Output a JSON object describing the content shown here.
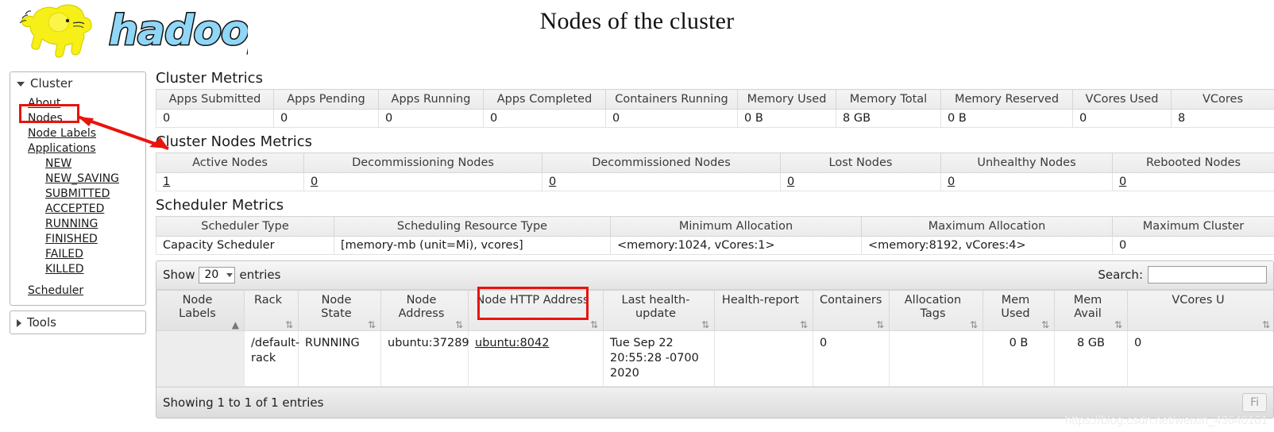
{
  "header": {
    "title": "Nodes of the cluster",
    "logo_text": "hadoop",
    "logo_icon": "hadoop-elephant-logo"
  },
  "sidebar": {
    "cluster": {
      "label": "Cluster",
      "expanded_icon": "triangle-down-icon",
      "items": [
        {
          "label": "About"
        },
        {
          "label": "Nodes"
        },
        {
          "label": "Node Labels"
        },
        {
          "label": "Applications"
        }
      ],
      "application_states": [
        {
          "label": "NEW"
        },
        {
          "label": "NEW_SAVING"
        },
        {
          "label": "SUBMITTED"
        },
        {
          "label": "ACCEPTED"
        },
        {
          "label": "RUNNING"
        },
        {
          "label": "FINISHED"
        },
        {
          "label": "FAILED"
        },
        {
          "label": "KILLED"
        }
      ],
      "scheduler": {
        "label": "Scheduler"
      }
    },
    "tools": {
      "label": "Tools",
      "collapsed_icon": "triangle-right-icon"
    }
  },
  "cluster_metrics": {
    "title": "Cluster Metrics",
    "headers": [
      "Apps Submitted",
      "Apps Pending",
      "Apps Running",
      "Apps Completed",
      "Containers Running",
      "Memory Used",
      "Memory Total",
      "Memory Reserved",
      "VCores Used",
      "VCores"
    ],
    "values": [
      "0",
      "0",
      "0",
      "0",
      "0",
      "0 B",
      "8 GB",
      "0 B",
      "0",
      "8"
    ]
  },
  "cluster_nodes_metrics": {
    "title": "Cluster Nodes Metrics",
    "headers": [
      "Active Nodes",
      "Decommissioning Nodes",
      "Decommissioned Nodes",
      "Lost Nodes",
      "Unhealthy Nodes",
      "Rebooted Nodes"
    ],
    "values": [
      "1",
      "0",
      "0",
      "0",
      "0",
      "0"
    ]
  },
  "scheduler_metrics": {
    "title": "Scheduler Metrics",
    "headers": [
      "Scheduler Type",
      "Scheduling Resource Type",
      "Minimum Allocation",
      "Maximum Allocation",
      "Maximum Cluster"
    ],
    "values": [
      "Capacity Scheduler",
      "[memory-mb (unit=Mi), vcores]",
      "<memory:1024, vCores:1>",
      "<memory:8192, vCores:4>",
      "0"
    ]
  },
  "nodes_table": {
    "show_label": "Show",
    "entries_label": "entries",
    "page_length": "20",
    "search_label": "Search:",
    "search_value": "",
    "search_placeholder": "",
    "headers": [
      {
        "label": "Node Labels",
        "sort": "asc"
      },
      {
        "label": "Rack",
        "sort": "none"
      },
      {
        "label": "Node State",
        "sort": "none"
      },
      {
        "label": "Node Address",
        "sort": "none"
      },
      {
        "label": "Node HTTP Address",
        "sort": "none"
      },
      {
        "label": "Last health-update",
        "sort": "none"
      },
      {
        "label": "Health-report",
        "sort": "none"
      },
      {
        "label": "Containers",
        "sort": "none"
      },
      {
        "label": "Allocation Tags",
        "sort": "none"
      },
      {
        "label": "Mem Used",
        "sort": "none"
      },
      {
        "label": "Mem Avail",
        "sort": "none"
      },
      {
        "label": "VCores U",
        "sort": "none"
      }
    ],
    "rows": [
      {
        "node_labels": "",
        "rack": "/default-rack",
        "node_state": "RUNNING",
        "node_address": "ubuntu:37289",
        "node_http_address": "ubuntu:8042",
        "last_health_update": "Tue Sep 22 20:55:28 -0700 2020",
        "health_report": "",
        "containers": "0",
        "allocation_tags": "",
        "mem_used": "0 B",
        "mem_avail": "8 GB",
        "vcores_used": "0"
      }
    ],
    "info": "Showing 1 to 1 of 1 entries",
    "pagination": {
      "first": "Fi"
    }
  },
  "annotations": {
    "highlight_color": "#e8140c",
    "boxes": [
      "nodes-sidebar-link",
      "node-http-address-cell"
    ],
    "arrow": "red-arrow-pointing-to-nodes"
  },
  "watermark": {
    "text": "https://blog.csdn.net/weixin_43640161"
  }
}
